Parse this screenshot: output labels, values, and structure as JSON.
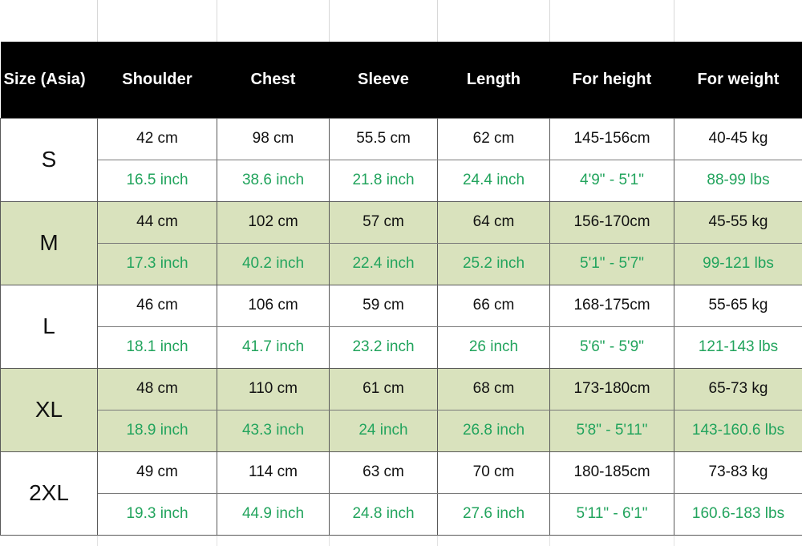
{
  "table": {
    "columns": [
      {
        "key": "size",
        "label": "Size (Asia)"
      },
      {
        "key": "shoulder",
        "label": "Shoulder"
      },
      {
        "key": "chest",
        "label": "Chest"
      },
      {
        "key": "sleeve",
        "label": "Sleeve"
      },
      {
        "key": "length",
        "label": "Length"
      },
      {
        "key": "height",
        "label": "For height"
      },
      {
        "key": "weight",
        "label": "For weight"
      }
    ],
    "colors": {
      "header_background": "#000000",
      "header_text": "#ffffff",
      "shaded_row_background": "#d9e2bd",
      "plain_row_background": "#ffffff",
      "cm_text": "#111111",
      "inch_text": "#22a45d",
      "grid_line": "#595959"
    },
    "rows": [
      {
        "size": "S",
        "shaded": false,
        "cm": {
          "shoulder": "42 cm",
          "chest": "98 cm",
          "sleeve": "55.5 cm",
          "length": "62 cm",
          "height": "145-156cm",
          "weight": "40-45 kg"
        },
        "inch": {
          "shoulder": "16.5 inch",
          "chest": "38.6 inch",
          "sleeve": "21.8 inch",
          "length": "24.4 inch",
          "height": "4'9\" - 5'1\"",
          "weight": "88-99 lbs"
        }
      },
      {
        "size": "M",
        "shaded": true,
        "cm": {
          "shoulder": "44 cm",
          "chest": "102 cm",
          "sleeve": "57 cm",
          "length": "64 cm",
          "height": "156-170cm",
          "weight": "45-55 kg"
        },
        "inch": {
          "shoulder": "17.3 inch",
          "chest": "40.2 inch",
          "sleeve": "22.4 inch",
          "length": "25.2 inch",
          "height": "5'1\" - 5'7\"",
          "weight": "99-121 lbs"
        }
      },
      {
        "size": "L",
        "shaded": false,
        "cm": {
          "shoulder": "46 cm",
          "chest": "106 cm",
          "sleeve": "59 cm",
          "length": "66 cm",
          "height": "168-175cm",
          "weight": "55-65 kg"
        },
        "inch": {
          "shoulder": "18.1 inch",
          "chest": "41.7 inch",
          "sleeve": "23.2 inch",
          "length": "26 inch",
          "height": "5'6\" - 5'9\"",
          "weight": "121-143 lbs"
        }
      },
      {
        "size": "XL",
        "shaded": true,
        "cm": {
          "shoulder": "48 cm",
          "chest": "110 cm",
          "sleeve": "61 cm",
          "length": "68 cm",
          "height": "173-180cm",
          "weight": "65-73 kg"
        },
        "inch": {
          "shoulder": "18.9 inch",
          "chest": "43.3 inch",
          "sleeve": "24 inch",
          "length": "26.8 inch",
          "height": "5'8\" - 5'11\"",
          "weight": "143-160.6 lbs"
        }
      },
      {
        "size": "2XL",
        "shaded": false,
        "cm": {
          "shoulder": "49 cm",
          "chest": "114 cm",
          "sleeve": "63 cm",
          "length": "70 cm",
          "height": "180-185cm",
          "weight": "73-83 kg"
        },
        "inch": {
          "shoulder": "19.3 inch",
          "chest": "44.9 inch",
          "sleeve": "24.8 inch",
          "length": "27.6 inch",
          "height": "5'11\" - 6'1\"",
          "weight": "160.6-183 lbs"
        }
      }
    ]
  },
  "layout": {
    "column_divider_positions": [
      121,
      270,
      410,
      545,
      685,
      840
    ]
  }
}
